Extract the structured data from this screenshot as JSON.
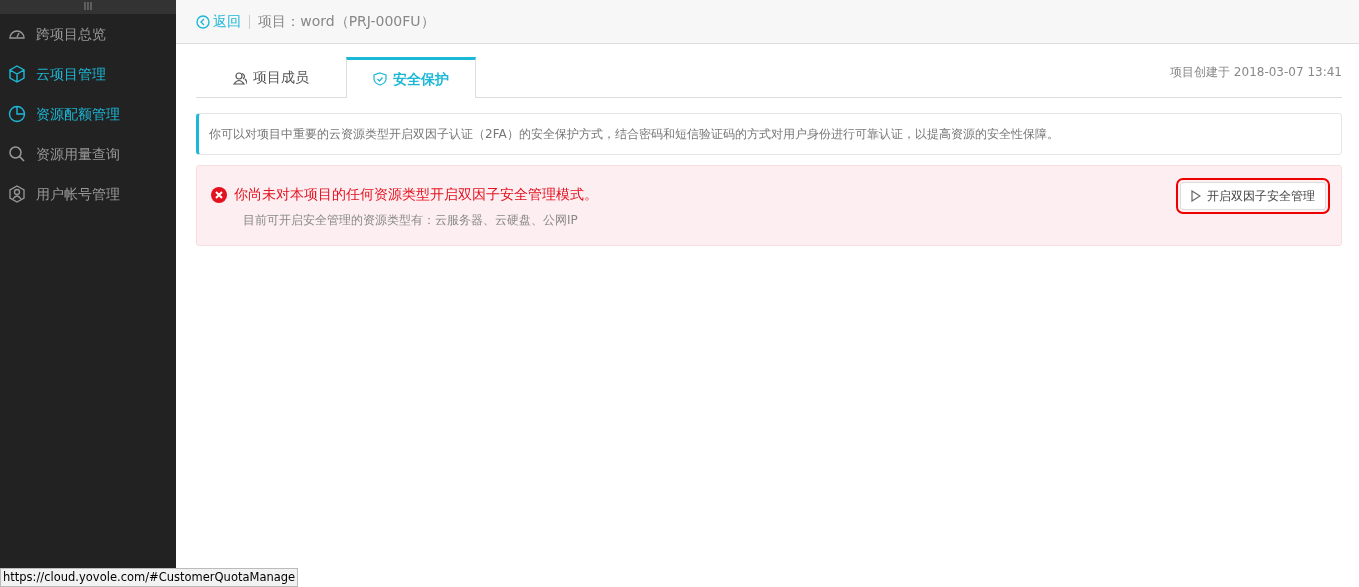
{
  "sidebar": {
    "handle": "III",
    "items": [
      {
        "label": "跨项目总览",
        "kind": "gauge",
        "selected": false
      },
      {
        "label": "云项目管理",
        "kind": "cube",
        "selected": true
      },
      {
        "label": "资源配额管理",
        "kind": "pie",
        "selected": true
      },
      {
        "label": "资源用量查询",
        "kind": "search",
        "selected": false
      },
      {
        "label": "用户帐号管理",
        "kind": "user",
        "selected": false
      }
    ]
  },
  "header": {
    "back": "返回",
    "project": "项目：word（PRJ-000FU）"
  },
  "tabs": [
    {
      "label": "项目成员",
      "kind": "users",
      "selected": false
    },
    {
      "label": "安全保护",
      "kind": "shield",
      "selected": true
    }
  ],
  "created": "项目创建于 2018-03-07 13:41",
  "info": "你可以对项目中重要的云资源类型开启双因子认证（2FA）的安全保护方式，结合密码和短信验证码的方式对用户身份进行可靠认证，以提高资源的安全性保障。",
  "alert": {
    "title": "你尚未对本项目的任何资源类型开启双因子安全管理模式。",
    "detail": "目前可开启安全管理的资源类型有：云服务器、云硬盘、公网IP",
    "button": {
      "label": "开启双因子安全管理",
      "highlighted": true
    }
  },
  "status_bar": "https://cloud.yovole.com/#CustomerQuotaManage"
}
